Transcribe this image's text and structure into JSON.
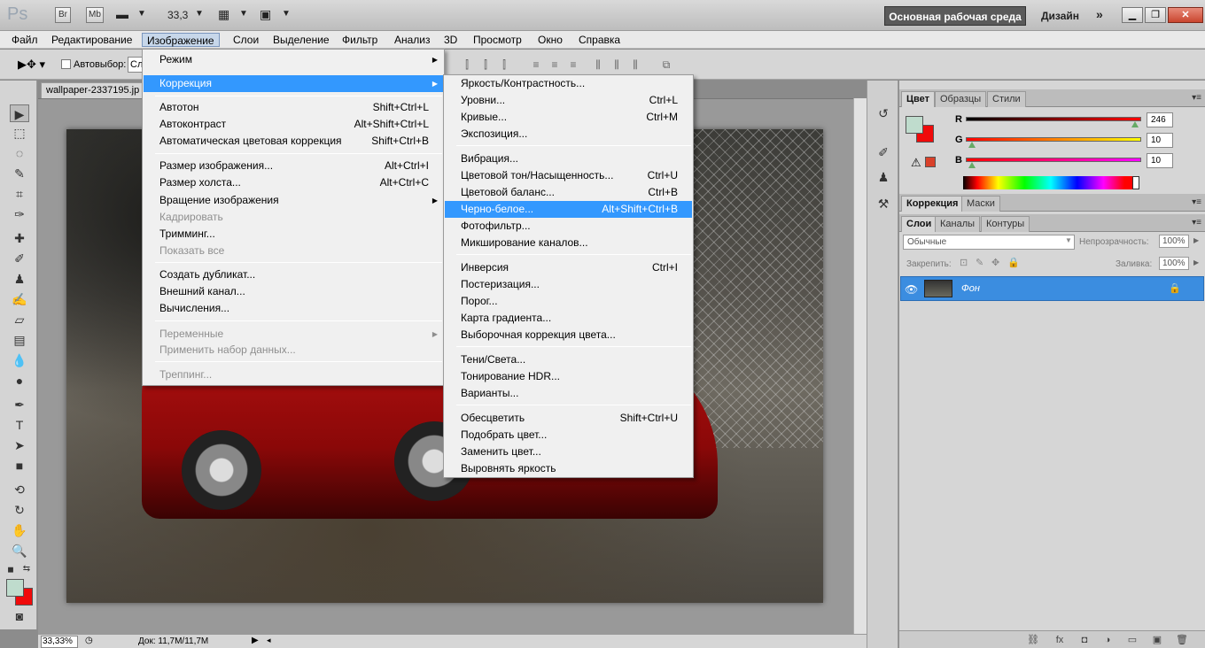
{
  "titlebar": {
    "app_logo": "Ps",
    "bridge_btn": "Br",
    "minibridge_btn": "Mb",
    "zoom_value": "33,3",
    "workspace_active": "Основная рабочая среда",
    "workspace_design": "Дизайн"
  },
  "menubar": {
    "items": [
      "Файл",
      "Редактирование",
      "Изображение",
      "Слои",
      "Выделение",
      "Фильтр",
      "Анализ",
      "3D",
      "Просмотр",
      "Окно",
      "Справка"
    ]
  },
  "optionsbar": {
    "autoselect_label": "Автовыбор:",
    "autoselect_value": "Сл"
  },
  "document": {
    "tab_name": "wallpaper-2337195.jp",
    "zoom_status": "33,33%",
    "doc_size": "Док: 11,7M/11,7M"
  },
  "image_menu": {
    "items": [
      {
        "label": "Режим",
        "shortcut": "",
        "submenu": true
      },
      {
        "label": "Коррекция",
        "shortcut": "",
        "submenu": true,
        "highlight": true
      },
      {
        "label": "Автотон",
        "shortcut": "Shift+Ctrl+L"
      },
      {
        "label": "Автоконтраст",
        "shortcut": "Alt+Shift+Ctrl+L"
      },
      {
        "label": "Автоматическая цветовая коррекция",
        "shortcut": "Shift+Ctrl+B"
      },
      {
        "label": "Размер изображения...",
        "shortcut": "Alt+Ctrl+I"
      },
      {
        "label": "Размер холста...",
        "shortcut": "Alt+Ctrl+C"
      },
      {
        "label": "Вращение изображения",
        "shortcut": "",
        "submenu": true
      },
      {
        "label": "Кадрировать",
        "shortcut": "",
        "disabled": true
      },
      {
        "label": "Тримминг...",
        "shortcut": ""
      },
      {
        "label": "Показать все",
        "shortcut": "",
        "disabled": true
      },
      {
        "label": "Создать дубликат...",
        "shortcut": ""
      },
      {
        "label": "Внешний канал...",
        "shortcut": ""
      },
      {
        "label": "Вычисления...",
        "shortcut": ""
      },
      {
        "label": "Переменные",
        "shortcut": "",
        "submenu": true,
        "disabled": true
      },
      {
        "label": "Применить набор данных...",
        "shortcut": "",
        "disabled": true
      },
      {
        "label": "Треппинг...",
        "shortcut": "",
        "disabled": true
      }
    ]
  },
  "correction_menu": {
    "items": [
      {
        "label": "Яркость/Контрастность...",
        "shortcut": ""
      },
      {
        "label": "Уровни...",
        "shortcut": "Ctrl+L"
      },
      {
        "label": "Кривые...",
        "shortcut": "Ctrl+M"
      },
      {
        "label": "Экспозиция...",
        "shortcut": ""
      },
      {
        "label": "Вибрация...",
        "shortcut": ""
      },
      {
        "label": "Цветовой тон/Насыщенность...",
        "shortcut": "Ctrl+U"
      },
      {
        "label": "Цветовой баланс...",
        "shortcut": "Ctrl+B"
      },
      {
        "label": "Черно-белое...",
        "shortcut": "Alt+Shift+Ctrl+B",
        "highlight": true
      },
      {
        "label": "Фотофильтр...",
        "shortcut": ""
      },
      {
        "label": "Микширование каналов...",
        "shortcut": ""
      },
      {
        "label": "Инверсия",
        "shortcut": "Ctrl+I"
      },
      {
        "label": "Постеризация...",
        "shortcut": ""
      },
      {
        "label": "Порог...",
        "shortcut": ""
      },
      {
        "label": "Карта градиента...",
        "shortcut": ""
      },
      {
        "label": "Выборочная коррекция цвета...",
        "shortcut": ""
      },
      {
        "label": "Тени/Света...",
        "shortcut": ""
      },
      {
        "label": "Тонирование HDR...",
        "shortcut": ""
      },
      {
        "label": "Варианты...",
        "shortcut": ""
      },
      {
        "label": "Обесцветить",
        "shortcut": "Shift+Ctrl+U"
      },
      {
        "label": "Подобрать цвет...",
        "shortcut": ""
      },
      {
        "label": "Заменить цвет...",
        "shortcut": ""
      },
      {
        "label": "Выровнять яркость",
        "shortcut": ""
      }
    ]
  },
  "color_panel": {
    "tabs": [
      "Цвет",
      "Образцы",
      "Стили"
    ],
    "r_label": "R",
    "g_label": "G",
    "b_label": "B",
    "r_value": "246",
    "g_value": "10",
    "b_value": "10",
    "foreground_color": "#bfdccd",
    "background_color": "#f00a0a"
  },
  "adjust_panel": {
    "tabs": [
      "Коррекция",
      "Маски"
    ]
  },
  "layers_panel": {
    "tabs": [
      "Слои",
      "Каналы",
      "Контуры"
    ],
    "blend_mode": "Обычные",
    "opacity_label": "Непрозрачность:",
    "opacity_value": "100%",
    "lock_label": "Закрепить:",
    "fill_label": "Заливка:",
    "fill_value": "100%",
    "layer_name": "Фон"
  }
}
